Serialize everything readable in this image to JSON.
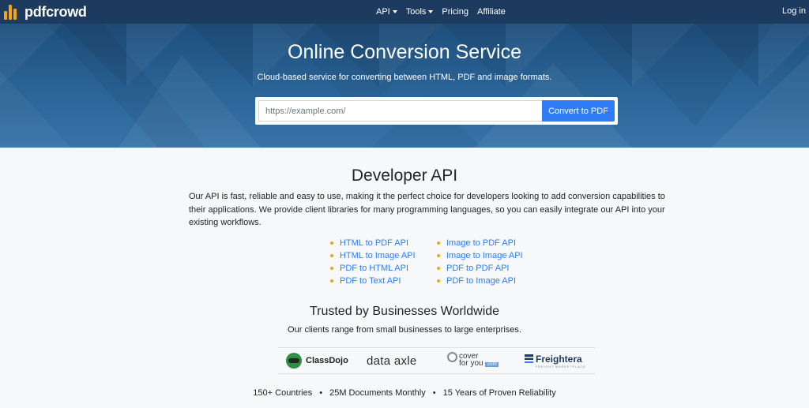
{
  "brand": {
    "name": "pdfcrowd",
    "accent": "#f7a21b",
    "nav_bg": "#1c3b5e"
  },
  "nav": {
    "items": [
      {
        "label": "API",
        "dropdown": true
      },
      {
        "label": "Tools",
        "dropdown": true
      },
      {
        "label": "Pricing",
        "dropdown": false
      },
      {
        "label": "Affiliate",
        "dropdown": false
      }
    ],
    "login_label": "Log in"
  },
  "hero": {
    "title": "Online Conversion Service",
    "subtitle": "Cloud-based service for converting between HTML, PDF and image formats.",
    "url_placeholder": "https://example.com/",
    "convert_label": "Convert to PDF",
    "button_color": "#2f7cf6"
  },
  "developer": {
    "title": "Developer API",
    "description": "Our API is fast, reliable and easy to use, making it the perfect choice for developers looking to add conversion capabilities to their applications. We provide client libraries for many programming languages, so you can easily integrate our API into your existing workflows.",
    "left_links": [
      "HTML to PDF API",
      "HTML to Image API",
      "PDF to HTML API",
      "PDF to Text API"
    ],
    "right_links": [
      "Image to PDF API",
      "Image to Image API",
      "PDF to PDF API",
      "PDF to Image API"
    ]
  },
  "trusted": {
    "title": "Trusted by Businesses Worldwide",
    "subtitle": "Our clients range from small businesses to large enterprises.",
    "logos": {
      "classdojo": "ClassDojo",
      "dataaxle": "data axle",
      "coverforyou_line1": "cover",
      "coverforyou_line2": "for you",
      "coverforyou_domain": ".com",
      "freightera": "Freightera",
      "freightera_tagline": "FREIGHT MARKETPLACE"
    },
    "stats": [
      "150+ Countries",
      "25M Documents Monthly",
      "15 Years of Proven Reliability"
    ],
    "separator": "•"
  }
}
